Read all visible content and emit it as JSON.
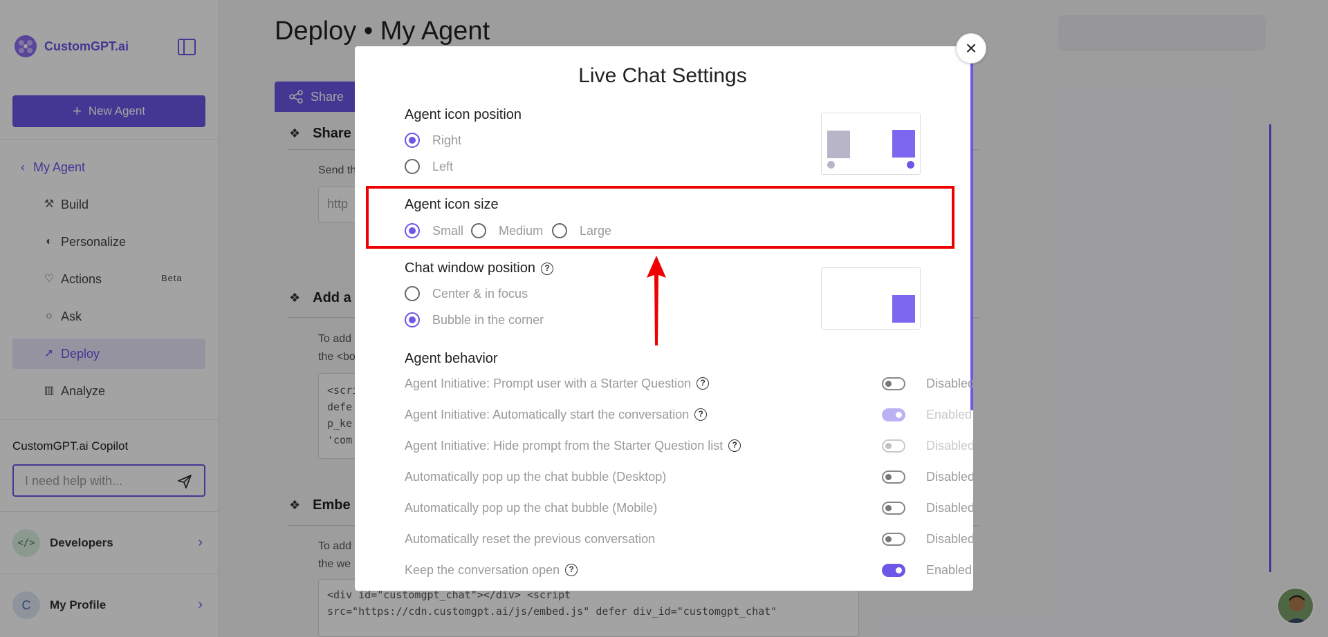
{
  "brand": {
    "name": "CustomGPT.ai"
  },
  "sidebar": {
    "new_agent_label": "New Agent",
    "back_label": "My Agent",
    "items": [
      {
        "label": "Build",
        "icon": "build-icon"
      },
      {
        "label": "Personalize",
        "icon": "palette-icon"
      },
      {
        "label": "Actions",
        "icon": "actions-icon",
        "badge": "Beta"
      },
      {
        "label": "Ask",
        "icon": "chat-icon"
      },
      {
        "label": "Deploy",
        "icon": "rocket-icon",
        "active": true
      },
      {
        "label": "Analyze",
        "icon": "chart-icon"
      }
    ],
    "copilot_title": "CustomGPT.ai Copilot",
    "copilot_placeholder": "I need help with...",
    "developers_label": "Developers",
    "developers_badge": "</>",
    "profile_label": "My Profile",
    "profile_initial": "C"
  },
  "main": {
    "title": "Deploy • My Agent",
    "share_tab": "Share",
    "sections": [
      {
        "title": "Share",
        "text": "Send th",
        "box": "http"
      },
      {
        "title": "Add a",
        "text_lines": [
          "To add",
          "the <bo"
        ],
        "box_lines": [
          "<scri",
          "defe",
          "p_ke",
          "'com"
        ]
      },
      {
        "title": "Embe",
        "text_lines": [
          "To add",
          "the we"
        ],
        "box_lines": [
          "<div id=\"customgpt_chat\"></div> <script",
          "src=\"https://cdn.customgpt.ai/js/embed.js\" defer div_id=\"customgpt_chat\""
        ]
      }
    ]
  },
  "modal": {
    "title": "Live Chat Settings",
    "icon_position": {
      "label": "Agent icon position",
      "options": [
        "Right",
        "Left"
      ],
      "selected": "Right"
    },
    "icon_size": {
      "label": "Agent icon size",
      "options": [
        "Small",
        "Medium",
        "Large"
      ],
      "selected": "Small"
    },
    "chat_position": {
      "label": "Chat window position",
      "options": [
        "Center & in focus",
        "Bubble in the corner"
      ],
      "selected": "Bubble in the corner"
    },
    "behavior": {
      "label": "Agent behavior",
      "rows": [
        {
          "label": "Agent Initiative: Prompt user with a Starter Question",
          "help": true,
          "state": "Disabled",
          "on": false,
          "faded": false
        },
        {
          "label": "Agent Initiative: Automatically start the conversation",
          "help": true,
          "state": "Enabled",
          "on": true,
          "faded": true
        },
        {
          "label": "Agent Initiative: Hide prompt from the Starter Question list",
          "help": true,
          "state": "Disabled",
          "on": false,
          "faded": true
        },
        {
          "label": "Automatically pop up the chat bubble (Desktop)",
          "help": false,
          "state": "Disabled",
          "on": false,
          "faded": false
        },
        {
          "label": "Automatically pop up the chat bubble (Mobile)",
          "help": false,
          "state": "Disabled",
          "on": false,
          "faded": false
        },
        {
          "label": "Automatically reset the previous conversation",
          "help": false,
          "state": "Disabled",
          "on": false,
          "faded": false
        },
        {
          "label": "Keep the conversation open",
          "help": true,
          "state": "Enabled",
          "on": true,
          "faded": false
        }
      ]
    },
    "help_glyph": "?",
    "close_glyph": "×"
  },
  "colors": {
    "accent": "#6b57e8",
    "highlight": "#ee0000"
  }
}
